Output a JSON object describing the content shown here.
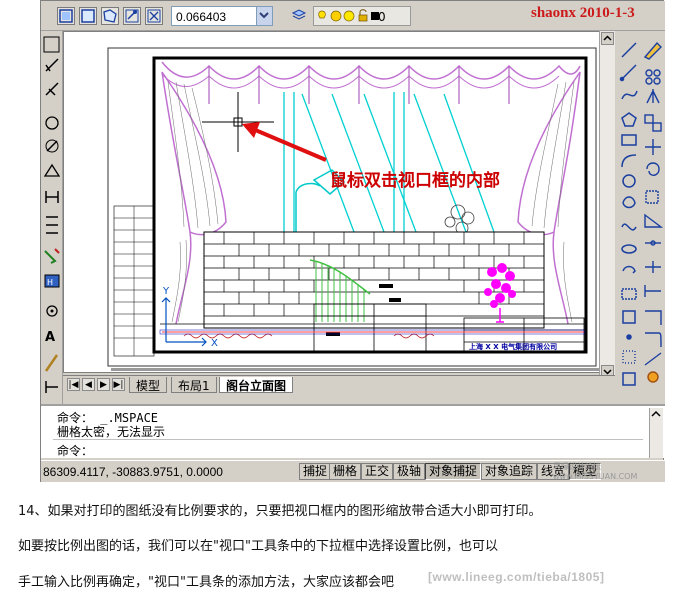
{
  "toolbar": {
    "scale_value": "0.066403",
    "layer_value": "0",
    "watermark": "shaonx  2010-1-3"
  },
  "drawing": {
    "annotation": "鼠标双击视口框的内部",
    "title_block": "上海 X X 电气集团有限公司",
    "axis_x": "X",
    "axis_y": "Y"
  },
  "tabs": [
    {
      "label": "模型"
    },
    {
      "label": "布局1"
    },
    {
      "label": "阁台立面图"
    }
  ],
  "command": {
    "line1": "命令： _.MSPACE",
    "line2": "栅格太密，无法显示",
    "prompt": "命令："
  },
  "status": {
    "coords": "86309.4117, -30883.9751, 0.0000",
    "buttons": [
      "捕捉",
      "栅格",
      "正交",
      "极轴",
      "对象捕捉",
      "对象追踪",
      "线宽",
      "模型"
    ],
    "watermark": "思缘设计论坛 www.MISSYUAN.COM"
  },
  "article": {
    "p1": "14、如果对打印的图纸没有比例要求的，只要把视口框内的图形缩放带合适大小即可打印。",
    "p2": "如要按比例出图的话，我们可以在\"视口\"工具条中的下拉框中选择设置比例，也可以",
    "p3": "手工输入比例再确定，\"视口\"工具条的添加方法，大家应该都会吧",
    "watermark": "[www.lineeg.com/tieba/1805]"
  },
  "colors": {
    "annotation": "#cc0000",
    "arrow": "#e01010",
    "curtain": "#c070d0",
    "cyan": "#00d0d0",
    "green": "#40c040",
    "magenta": "#ff00ff"
  }
}
